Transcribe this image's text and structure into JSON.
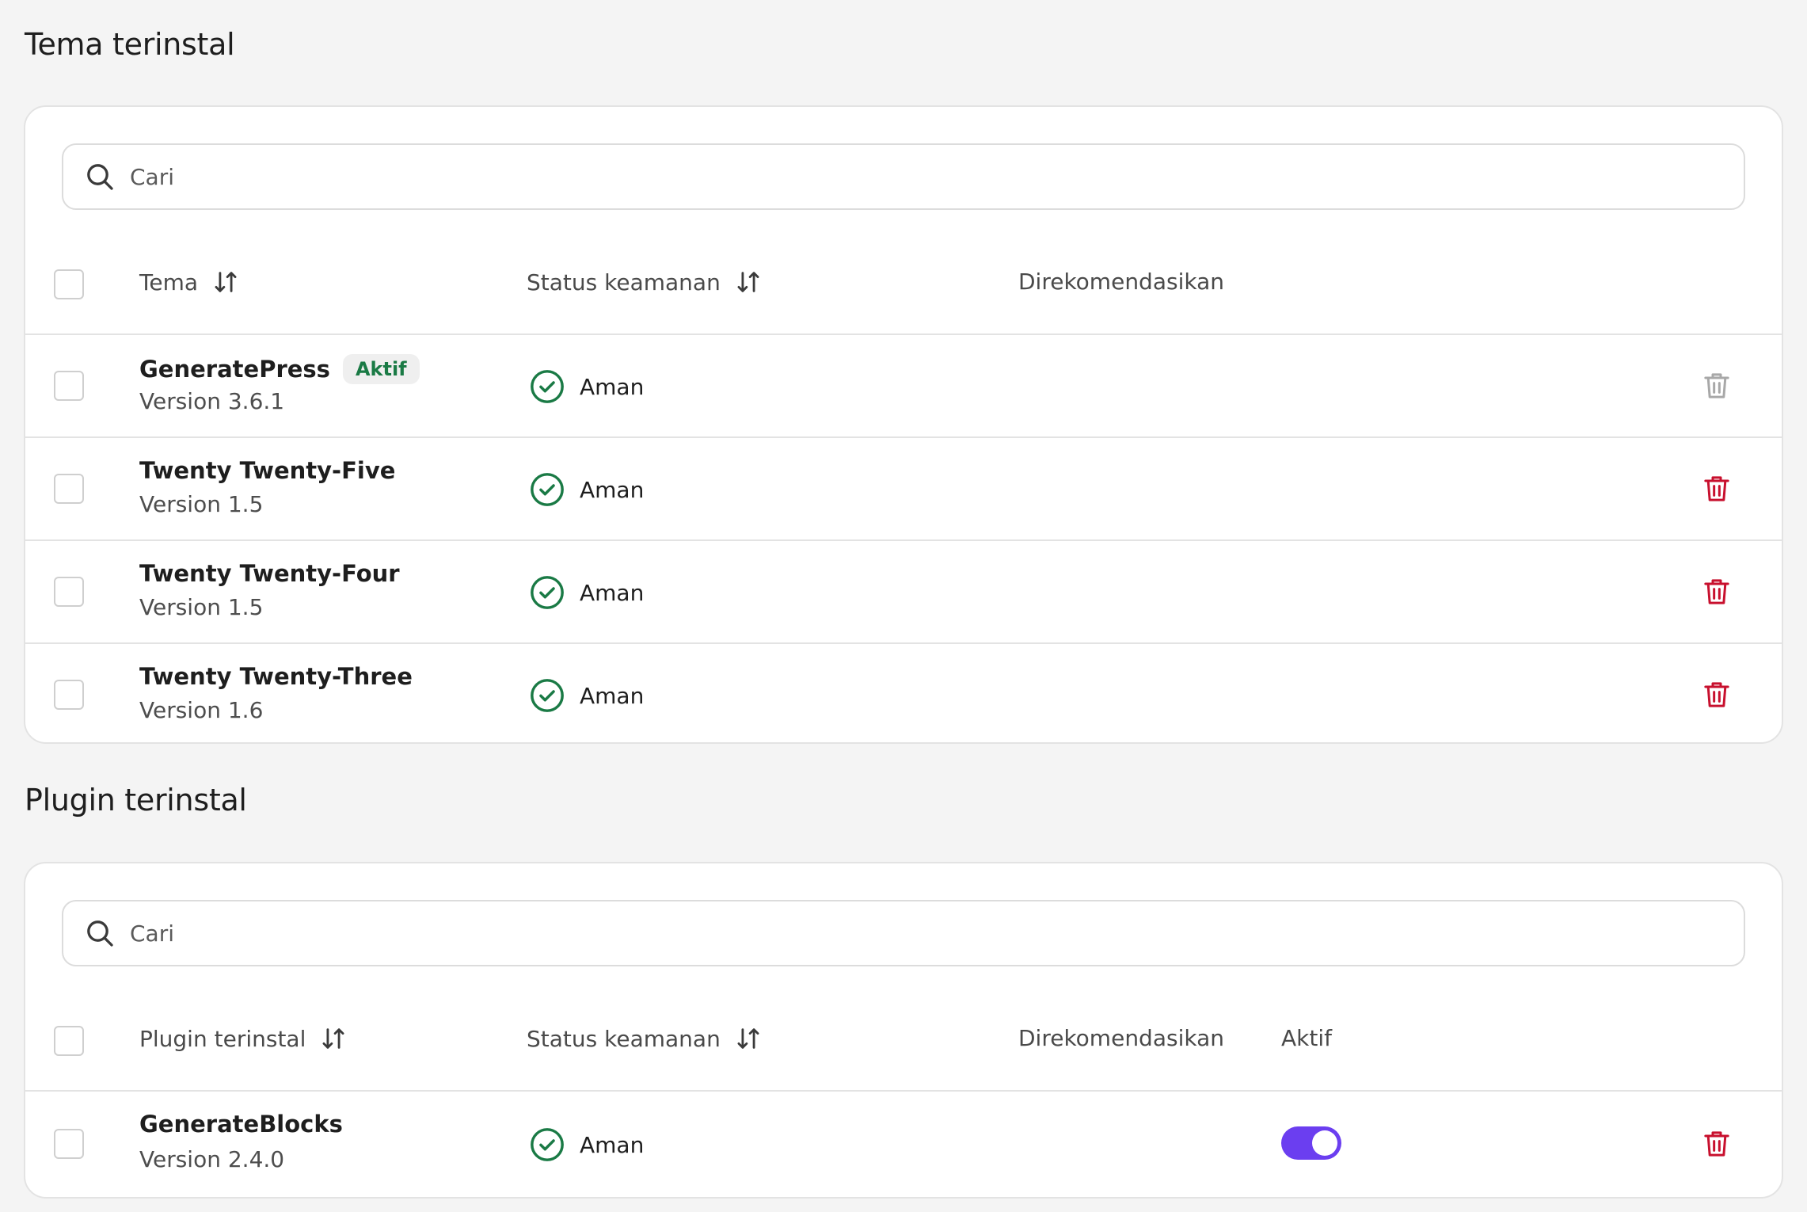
{
  "themes": {
    "title": "Tema terinstal",
    "search": {
      "placeholder": "Cari"
    },
    "columns": {
      "name": "Tema",
      "status": "Status keamanan",
      "recommended": "Direkomendasikan"
    },
    "rows": [
      {
        "name": "GeneratePress",
        "badge": "Aktif",
        "version": "Version 3.6.1",
        "status": "Aman",
        "delete_enabled": false
      },
      {
        "name": "Twenty Twenty-Five",
        "version": "Version 1.5",
        "status": "Aman",
        "delete_enabled": true
      },
      {
        "name": "Twenty Twenty-Four",
        "version": "Version 1.5",
        "status": "Aman",
        "delete_enabled": true
      },
      {
        "name": "Twenty Twenty-Three",
        "version": "Version 1.6",
        "status": "Aman",
        "delete_enabled": true
      }
    ]
  },
  "plugins": {
    "title": "Plugin terinstal",
    "search": {
      "placeholder": "Cari"
    },
    "columns": {
      "name": "Plugin terinstal",
      "status": "Status keamanan",
      "recommended": "Direkomendasikan",
      "active": "Aktif"
    },
    "rows": [
      {
        "name": "GenerateBlocks",
        "version": "Version 2.4.0",
        "status": "Aman",
        "active": true,
        "delete_enabled": true
      }
    ]
  },
  "icons": {
    "search": "search-icon",
    "sort": "sort-arrows-icon",
    "status": "check-circle-icon",
    "delete": "trash-icon"
  },
  "colors": {
    "safe_green": "#1a7a45",
    "delete_red": "#c8102e",
    "delete_disabled": "#a8a8a8",
    "toggle_on": "#6b3ef0",
    "badge_bg": "#efefef"
  }
}
